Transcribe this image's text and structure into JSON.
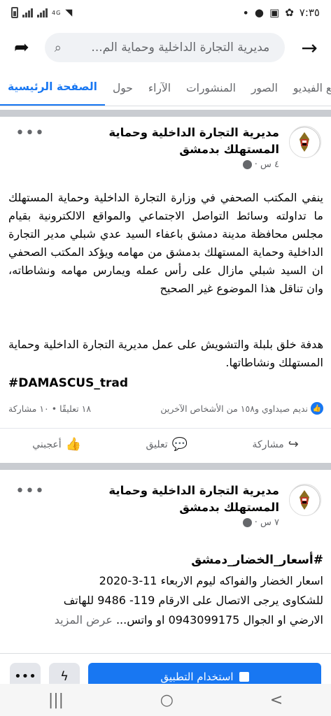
{
  "status_bar": {
    "time": "٧:٣٥",
    "network": "4G"
  },
  "search": {
    "text": "مديرية التجارة الداخلية وحماية الم..."
  },
  "tabs": [
    {
      "label": "الصفحة الرئيسية",
      "active": true
    },
    {
      "label": "حول",
      "active": false
    },
    {
      "label": "الآراء",
      "active": false
    },
    {
      "label": "المنشورات",
      "active": false
    },
    {
      "label": "الصور",
      "active": false
    },
    {
      "label": "مقاطع الفيديو",
      "active": false
    }
  ],
  "post1": {
    "page_name": "مديرية التجارة الداخلية وحماية المستهلك بدمشق",
    "time": "٤ س ·",
    "body": "ينفي المكتب الصحفي في وزارة التجارة الداخلية وحماية المستهلك ما تداولته وسائط التواصل الاجتماعي والمواقع الالكترونية بقيام مجلس محافظة مدينة دمشق باعفاء السيد عدي شبلي مدير التجارة الداخلية وحماية المستهلك بدمشق من مهامه ويؤكد المكتب الصحفي ان السيد شبلي مازال على رأس عمله ويمارس مهامه ونشاطاته، وان تناقل هذا الموضوع غير الصحيح",
    "body2": "هدفة خلق بلبلة والتشويش على عمل مديرية التجارة الداخلية وحماية المستهلك ونشاطاتها.",
    "hashtag": "#DAMASCUS_trad",
    "reactions_text": "نديم صيداوي و١٥٨ من الأشخاص الآخرين",
    "counts_text": "١٨ تعليقًا • ١٠ مشاركة",
    "actions": {
      "like": "أعجبني",
      "comment": "تعليق",
      "share": "مشاركة"
    }
  },
  "post2": {
    "page_name": "مديرية التجارة الداخلية وحماية المستهلك بدمشق",
    "time": "٧ س ·",
    "title": "#أسعار_الخضار_دمشق",
    "line1": "اسعار الخضار والفواكه ليوم الاربعاء 11-3-2020",
    "line2": "للشكاوى يرجى الاتصال على الارقام 119- 9486 للهاتف",
    "line3": "الارضي او الجوال 0943099175 او واتس...",
    "see_more": "عرض المزيد"
  },
  "app_bar": {
    "more": "•••",
    "use_app": "استخدام التطبيق"
  },
  "nav": {
    "recent": "|||",
    "home": "○",
    "back": "<"
  }
}
